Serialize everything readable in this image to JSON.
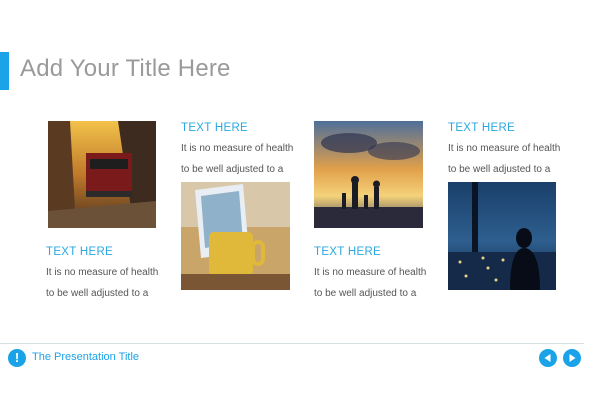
{
  "slide": {
    "title": "Add Your Title Here"
  },
  "captions": [
    {
      "heading": "TEXT HERE",
      "line1": "It is no measure of health",
      "line2": "to be well adjusted to a"
    },
    {
      "heading": "TEXT HERE",
      "line1": "It is no measure of health",
      "line2": "to be well adjusted to a"
    },
    {
      "heading": "TEXT HERE",
      "line1": "It is no measure of health",
      "line2": "to be well adjusted to a"
    },
    {
      "heading": "TEXT HERE",
      "line1": "It is no measure of health",
      "line2": "to be well adjusted to a"
    }
  ],
  "footer": {
    "presentation_title": "The Presentation Title",
    "info_icon": "!"
  },
  "icons": {
    "prev": "triangle-left",
    "next": "triangle-right",
    "info": "exclamation-circle"
  },
  "colors": {
    "accent": "#1aa3e8",
    "title": "#9a9a9a",
    "body_text": "#555555"
  }
}
